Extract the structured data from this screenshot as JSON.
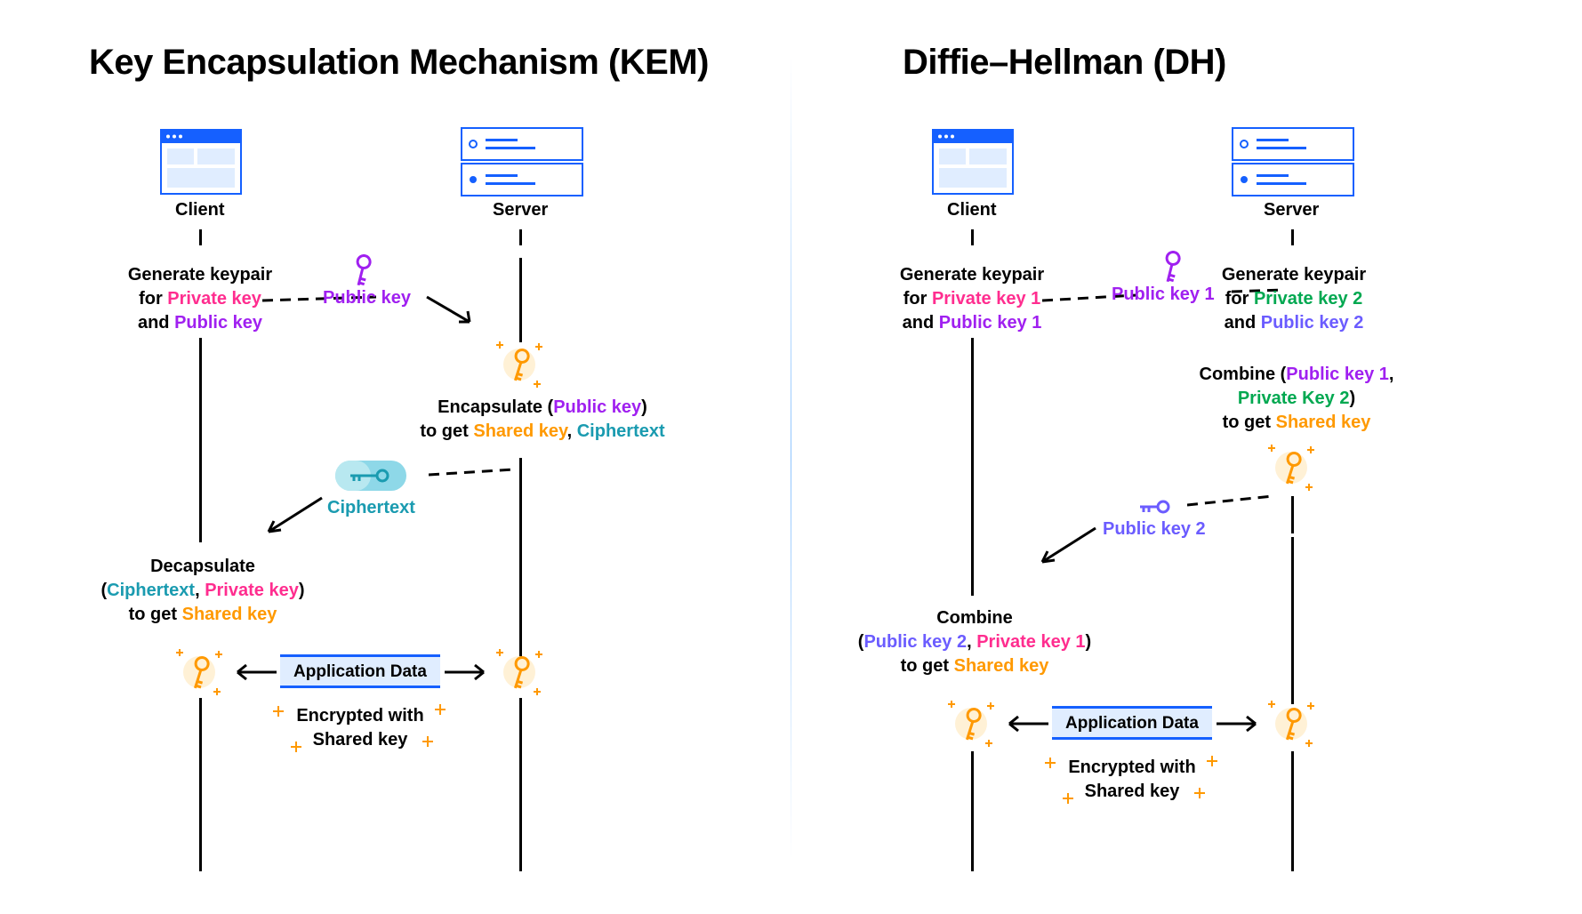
{
  "kem": {
    "title": "Key Encapsulation Mechanism (KEM)",
    "client": "Client",
    "server": "Server",
    "gen_l1": "Generate keypair",
    "gen_l2a": "for ",
    "gen_pk": "Private key",
    "gen_l3a": "and ",
    "gen_pub": "Public key",
    "pubkey_msg": "Public key",
    "encap_l1a": "Encapsulate (",
    "encap_pub": "Public key",
    "encap_l1b": ")",
    "encap_l2a": "to get ",
    "encap_shared": "Shared key",
    "encap_comma": ", ",
    "encap_cipher": "Ciphertext",
    "cipher_msg": "Ciphertext",
    "decap_l1": "Decapsulate",
    "decap_l2a": "(",
    "decap_cipher": "Ciphertext",
    "decap_comma": ", ",
    "decap_priv": "Private key",
    "decap_l2b": ")",
    "decap_l3a": "to get  ",
    "decap_shared": "Shared key",
    "appdata": "Application Data",
    "encwith1": "Encrypted with",
    "encwith2": "Shared key"
  },
  "dh": {
    "title": "Diffie–Hellman (DH)",
    "client": "Client",
    "server": "Server",
    "gen1_l1": "Generate keypair",
    "gen1_l2a": "for ",
    "gen1_pk": "Private key 1",
    "gen1_l3a": "and ",
    "gen1_pub": "Public key 1",
    "pub1_msg": "Public key 1",
    "gen2_l1": "Generate keypair",
    "gen2_l2a": "for ",
    "gen2_pk": "Private key 2",
    "gen2_l3a": "and ",
    "gen2_pub": "Public key 2",
    "combS_l1a": "Combine (",
    "combS_pub1": "Public key 1",
    "combS_comma": ",",
    "combS_pk2": "Private Key 2",
    "combS_l2b": ")",
    "combS_l3a": "to get ",
    "combS_shared": "Shared key",
    "pub2_msg": "Public key 2",
    "combC_l1": "Combine",
    "combC_l2a": "(",
    "combC_pub2": "Public key 2",
    "combC_comma": ", ",
    "combC_pk1": "Private key 1",
    "combC_l2b": ")",
    "combC_l3a": "to get  ",
    "combC_shared": "Shared key",
    "appdata": "Application Data",
    "encwith1": "Encrypted with",
    "encwith2": "Shared key"
  }
}
